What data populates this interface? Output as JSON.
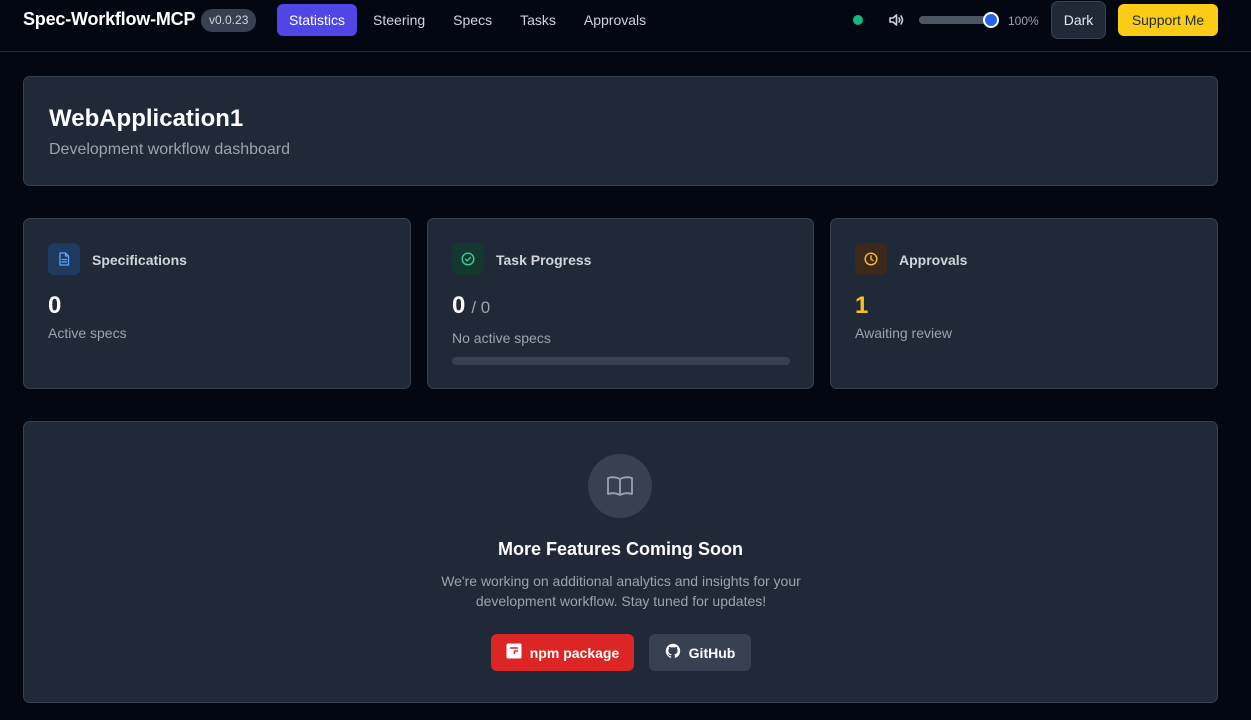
{
  "header": {
    "brand": "Spec-Workflow-MCP",
    "version": "v0.0.23",
    "tabs": [
      {
        "label": "Statistics",
        "active": true
      },
      {
        "label": "Steering",
        "active": false
      },
      {
        "label": "Specs",
        "active": false
      },
      {
        "label": "Tasks",
        "active": false
      },
      {
        "label": "Approvals",
        "active": false
      }
    ],
    "connection_status_color": "#10b981",
    "volume_icon": "volume-icon",
    "volume_level": 1.0,
    "zoom_label": "100%",
    "theme_button_label": "Dark",
    "support_button_label": "Support Me"
  },
  "project": {
    "title": "WebApplication1",
    "subtitle": "Development workflow dashboard"
  },
  "stats": {
    "specifications": {
      "icon": "document-icon",
      "title": "Specifications",
      "value": "0",
      "caption": "Active specs",
      "accent": "#3b82f6"
    },
    "task_progress": {
      "icon": "check-circle-icon",
      "title": "Task Progress",
      "value": "0",
      "denominator": "/ 0",
      "caption": "No active specs",
      "progress": 0,
      "accent": "#10b981"
    },
    "approvals": {
      "icon": "clock-icon",
      "title": "Approvals",
      "value": "1",
      "caption": "Awaiting review",
      "accent": "#f59e0b"
    }
  },
  "features": {
    "icon": "book-open-icon",
    "title": "More Features Coming Soon",
    "line1": "We're working on additional analytics and insights for your",
    "line2": "development workflow. Stay tuned for updates!",
    "npm_button_label": "npm package",
    "github_button_label": "GitHub"
  },
  "colors": {
    "accent_primary": "#4f46e5",
    "support_yellow": "#facc15",
    "npm_red": "#dc2626",
    "approvals_value": "#fbbf24"
  }
}
